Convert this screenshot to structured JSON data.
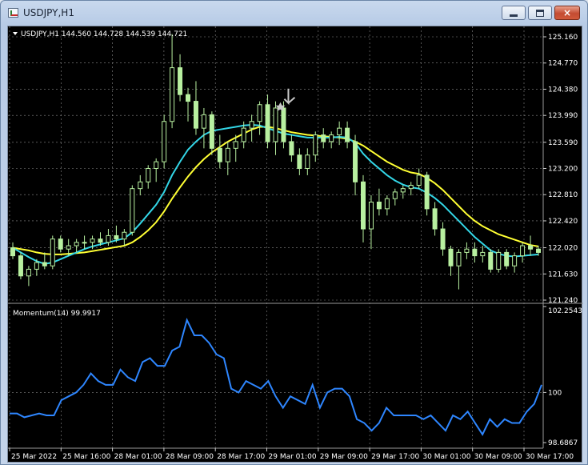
{
  "window": {
    "title": "USDJPY,H1",
    "buttons": {
      "minimize": "minimize",
      "maximize": "maximize",
      "close": "×"
    }
  },
  "chart_info": {
    "symbol_line": "USDJPY,H1  144.560 144.728 144.539 144.721"
  },
  "momentum_info": {
    "label": "Momentum(14) 99.9917"
  },
  "price_axis": [
    "125.160",
    "124.770",
    "124.380",
    "123.990",
    "123.590",
    "123.200",
    "122.810",
    "122.420",
    "122.020",
    "121.630",
    "121.240"
  ],
  "momentum_axis": [
    "102.2543",
    "100",
    "98.6867"
  ],
  "time_axis": [
    "25 Mar 2022",
    "25 Mar 16:00",
    "28 Mar 01:00",
    "28 Mar 09:00",
    "28 Mar 17:00",
    "29 Mar 01:00",
    "29 Mar 09:00",
    "29 Mar 17:00",
    "30 Mar 01:00",
    "30 Mar 09:00",
    "30 Mar 17:00"
  ],
  "colors": {
    "background": "#000000",
    "grid": "#8a8a8a",
    "candle": "#b8f0a0",
    "fast_ma": "#33d6e6",
    "slow_ma": "#ffff33",
    "momentum": "#2e86ff",
    "arrow": "#c8c8c8"
  },
  "chart_data": [
    {
      "type": "candlestick",
      "symbol": "USDJPY",
      "timeframe": "H1",
      "ylim": [
        121.24,
        125.16
      ],
      "grid": true,
      "candles": [
        [
          122.02,
          122.1,
          121.85,
          121.9
        ],
        [
          121.9,
          121.95,
          121.55,
          121.6
        ],
        [
          121.6,
          121.75,
          121.45,
          121.7
        ],
        [
          121.7,
          121.85,
          121.6,
          121.8
        ],
        [
          121.8,
          121.95,
          121.7,
          121.75
        ],
        [
          121.75,
          122.2,
          121.7,
          122.15
        ],
        [
          122.15,
          122.2,
          121.95,
          122.0
        ],
        [
          122.0,
          122.15,
          121.9,
          122.05
        ],
        [
          122.05,
          122.15,
          121.95,
          122.1
        ],
        [
          122.1,
          122.2,
          122.0,
          122.1
        ],
        [
          122.1,
          122.2,
          122.0,
          122.15
        ],
        [
          122.15,
          122.25,
          122.05,
          122.1
        ],
        [
          122.1,
          122.3,
          122.05,
          122.2
        ],
        [
          122.2,
          122.35,
          122.1,
          122.15
        ],
        [
          122.15,
          122.3,
          122.05,
          122.25
        ],
        [
          122.25,
          122.95,
          122.2,
          122.9
        ],
        [
          122.9,
          123.1,
          122.8,
          123.0
        ],
        [
          123.0,
          123.25,
          122.9,
          123.2
        ],
        [
          123.2,
          123.35,
          123.0,
          123.3
        ],
        [
          123.3,
          124.0,
          123.2,
          123.9
        ],
        [
          123.9,
          125.2,
          123.8,
          124.7
        ],
        [
          124.7,
          124.9,
          124.2,
          124.3
        ],
        [
          124.3,
          124.4,
          123.9,
          124.2
        ],
        [
          124.2,
          124.5,
          123.7,
          123.8
        ],
        [
          123.8,
          124.1,
          123.5,
          124.0
        ],
        [
          124.0,
          124.05,
          123.4,
          123.5
        ],
        [
          123.5,
          123.7,
          123.2,
          123.3
        ],
        [
          123.3,
          123.6,
          123.1,
          123.5
        ],
        [
          123.5,
          123.7,
          123.3,
          123.6
        ],
        [
          123.6,
          123.9,
          123.5,
          123.8
        ],
        [
          123.8,
          124.0,
          123.6,
          123.9
        ],
        [
          123.9,
          124.2,
          123.7,
          124.15
        ],
        [
          124.15,
          124.3,
          123.5,
          123.6
        ],
        [
          123.6,
          124.2,
          123.4,
          124.1
        ],
        [
          124.1,
          124.2,
          123.5,
          123.6
        ],
        [
          123.6,
          123.7,
          123.3,
          123.4
        ],
        [
          123.4,
          123.5,
          123.1,
          123.2
        ],
        [
          123.2,
          123.5,
          123.1,
          123.4
        ],
        [
          123.4,
          123.75,
          123.3,
          123.7
        ],
        [
          123.7,
          123.8,
          123.5,
          123.6
        ],
        [
          123.6,
          123.75,
          123.5,
          123.7
        ],
        [
          123.7,
          123.9,
          123.55,
          123.8
        ],
        [
          123.8,
          123.9,
          123.5,
          123.6
        ],
        [
          123.6,
          123.7,
          122.8,
          123.0
        ],
        [
          123.0,
          123.1,
          122.1,
          122.3
        ],
        [
          122.3,
          122.8,
          122.0,
          122.7
        ],
        [
          122.7,
          122.9,
          122.5,
          122.6
        ],
        [
          122.6,
          122.8,
          122.5,
          122.75
        ],
        [
          122.75,
          122.9,
          122.65,
          122.85
        ],
        [
          122.85,
          122.95,
          122.75,
          122.9
        ],
        [
          122.9,
          123.0,
          122.8,
          122.95
        ],
        [
          122.95,
          123.2,
          122.9,
          123.1
        ],
        [
          123.1,
          123.15,
          122.5,
          122.6
        ],
        [
          122.6,
          122.7,
          122.2,
          122.3
        ],
        [
          122.3,
          122.4,
          121.9,
          122.0
        ],
        [
          122.0,
          122.05,
          121.6,
          121.75
        ],
        [
          121.75,
          122.0,
          121.4,
          121.95
        ],
        [
          121.95,
          122.1,
          121.85,
          122.0
        ],
        [
          122.0,
          122.1,
          121.8,
          121.9
        ],
        [
          121.9,
          122.05,
          121.8,
          121.95
        ],
        [
          121.95,
          122.0,
          121.65,
          121.7
        ],
        [
          121.7,
          122.0,
          121.65,
          121.95
        ],
        [
          121.95,
          122.0,
          121.7,
          121.75
        ],
        [
          121.75,
          121.95,
          121.65,
          121.9
        ],
        [
          121.9,
          122.1,
          121.8,
          122.05
        ],
        [
          122.05,
          122.2,
          121.9,
          122.0
        ],
        [
          122.0,
          122.05,
          121.9,
          121.95
        ]
      ],
      "fast_ma": [
        122.02,
        121.95,
        121.88,
        121.82,
        121.78,
        121.8,
        121.85,
        121.9,
        121.95,
        122.0,
        122.04,
        122.07,
        122.1,
        122.13,
        122.16,
        122.25,
        122.38,
        122.52,
        122.66,
        122.85,
        123.1,
        123.3,
        123.48,
        123.6,
        123.7,
        123.76,
        123.78,
        123.8,
        123.82,
        123.84,
        123.85,
        123.84,
        123.8,
        123.76,
        123.72,
        123.7,
        123.68,
        123.66,
        123.66,
        123.66,
        123.66,
        123.67,
        123.66,
        123.58,
        123.42,
        123.3,
        123.2,
        123.1,
        123.02,
        122.96,
        122.92,
        122.9,
        122.84,
        122.76,
        122.66,
        122.54,
        122.42,
        122.3,
        122.18,
        122.08,
        121.98,
        121.93,
        121.9,
        121.89,
        121.9,
        121.91,
        121.92
      ],
      "slow_ma": [
        122.02,
        122.0,
        121.98,
        121.95,
        121.93,
        121.92,
        121.92,
        121.93,
        121.94,
        121.95,
        121.97,
        121.99,
        122.01,
        122.03,
        122.05,
        122.1,
        122.18,
        122.28,
        122.4,
        122.56,
        122.75,
        122.92,
        123.08,
        123.22,
        123.34,
        123.44,
        123.52,
        123.6,
        123.66,
        123.72,
        123.78,
        123.82,
        123.82,
        123.8,
        123.77,
        123.74,
        123.72,
        123.7,
        123.69,
        123.68,
        123.67,
        123.66,
        123.64,
        123.6,
        123.54,
        123.46,
        123.38,
        123.3,
        123.24,
        123.18,
        123.14,
        123.12,
        123.06,
        122.98,
        122.88,
        122.76,
        122.64,
        122.52,
        122.42,
        122.34,
        122.28,
        122.22,
        122.18,
        122.14,
        122.1,
        122.06,
        122.04
      ]
    },
    {
      "type": "line",
      "name": "Momentum(14)",
      "ylim": [
        98.6867,
        102.2543
      ],
      "values": [
        99.45,
        99.45,
        99.35,
        99.4,
        99.45,
        99.4,
        99.4,
        99.8,
        99.9,
        100.0,
        100.2,
        100.5,
        100.3,
        100.2,
        100.2,
        100.6,
        100.4,
        100.3,
        100.8,
        100.9,
        100.7,
        100.7,
        101.1,
        101.2,
        101.9,
        101.5,
        101.5,
        101.3,
        101.0,
        100.9,
        100.1,
        100.0,
        100.3,
        100.2,
        100.1,
        100.3,
        99.9,
        99.6,
        99.9,
        99.8,
        99.7,
        100.2,
        99.6,
        100.0,
        100.1,
        100.1,
        99.9,
        99.3,
        99.2,
        99.0,
        99.2,
        99.6,
        99.4,
        99.4,
        99.4,
        99.4,
        99.3,
        99.4,
        99.2,
        99.0,
        99.4,
        99.3,
        99.5,
        99.2,
        98.9,
        99.3,
        99.1,
        99.3,
        99.2,
        99.2,
        99.5,
        99.7,
        100.2
      ]
    }
  ]
}
